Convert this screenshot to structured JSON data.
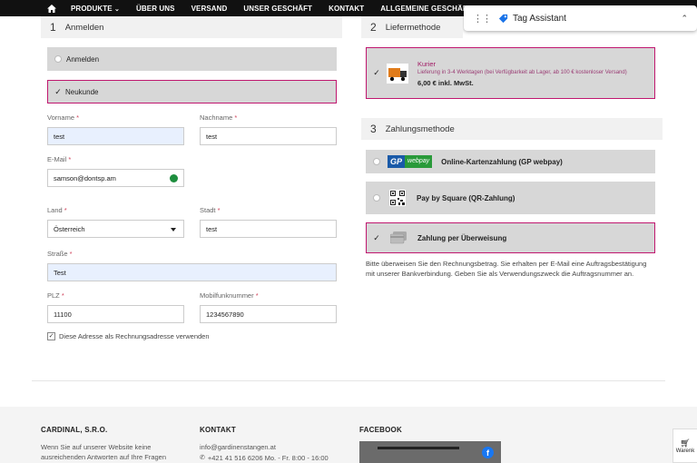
{
  "nav": {
    "items": [
      "PRODUKTE",
      "ÜBER UNS",
      "VERSAND",
      "UNSER GESCHÄFT",
      "KONTAKT",
      "ALLGEMEINE GESCHÄFTSBEDI"
    ]
  },
  "tag_assistant": {
    "title": "Tag Assistant"
  },
  "login_section": {
    "number": "1",
    "title": "Anmelden",
    "opt_login": "Anmelden",
    "opt_new": "Neukunde"
  },
  "form": {
    "vorname_label": "Vorname",
    "vorname_value": "test",
    "nachname_label": "Nachname",
    "nachname_value": "test",
    "email_label": "E-Mail",
    "email_value": "samson@dontsp.am",
    "land_label": "Land",
    "land_value": "Österreich",
    "stadt_label": "Stadt",
    "stadt_value": "test",
    "strasse_label": "Straße",
    "strasse_value": "Test",
    "plz_label": "PLZ",
    "plz_value": "11100",
    "mobil_label": "Mobilfunknummer",
    "mobil_value": "1234567890",
    "billing_checkbox": "Diese Adresse als Rechnungsadresse verwenden",
    "required_mark": "*"
  },
  "delivery": {
    "number": "2",
    "title": "Liefermethode",
    "courier_name": "Kurier",
    "courier_desc": "Lieferung in 3-4 Werktagen (bei Verfügbarkeit ab Lager, ab 100 € kostenloser Versand)",
    "courier_price": "6,00 € inkl. MwSt."
  },
  "payment": {
    "number": "3",
    "title": "Zahlungsmethode",
    "gp_logo_left": "GP",
    "gp_logo_right": "webpay",
    "opt_gp": "Online-Kartenzahlung (GP webpay)",
    "opt_square": "Pay by Square (QR-Zahlung)",
    "opt_transfer": "Zahlung per Überweisung",
    "transfer_note": "Bitte überweisen Sie den Rechnungsbetrag. Sie erhalten per E-Mail eine Auftragsbestätigung mit unserer Bankverbindung. Geben Sie als Verwendungszweck die Auftragsnummer an."
  },
  "footer": {
    "col1_head": "CARDINAL, S.R.O.",
    "col1_text": "Wenn Sie auf unserer Website keine ausreichenden Antworten auf Ihre Fragen",
    "col2_head": "KONTAKT",
    "col2_email": "info@gardinenstangen.at",
    "col2_phone": "+421 41 516 6206 Mo. - Fr. 8:00 - 16:00",
    "col3_head": "FACEBOOK",
    "cart_label": "Warenk"
  },
  "colors": {
    "accent": "#c0176f",
    "nav_bg": "#111111",
    "option_bg": "#d7d7d7"
  }
}
